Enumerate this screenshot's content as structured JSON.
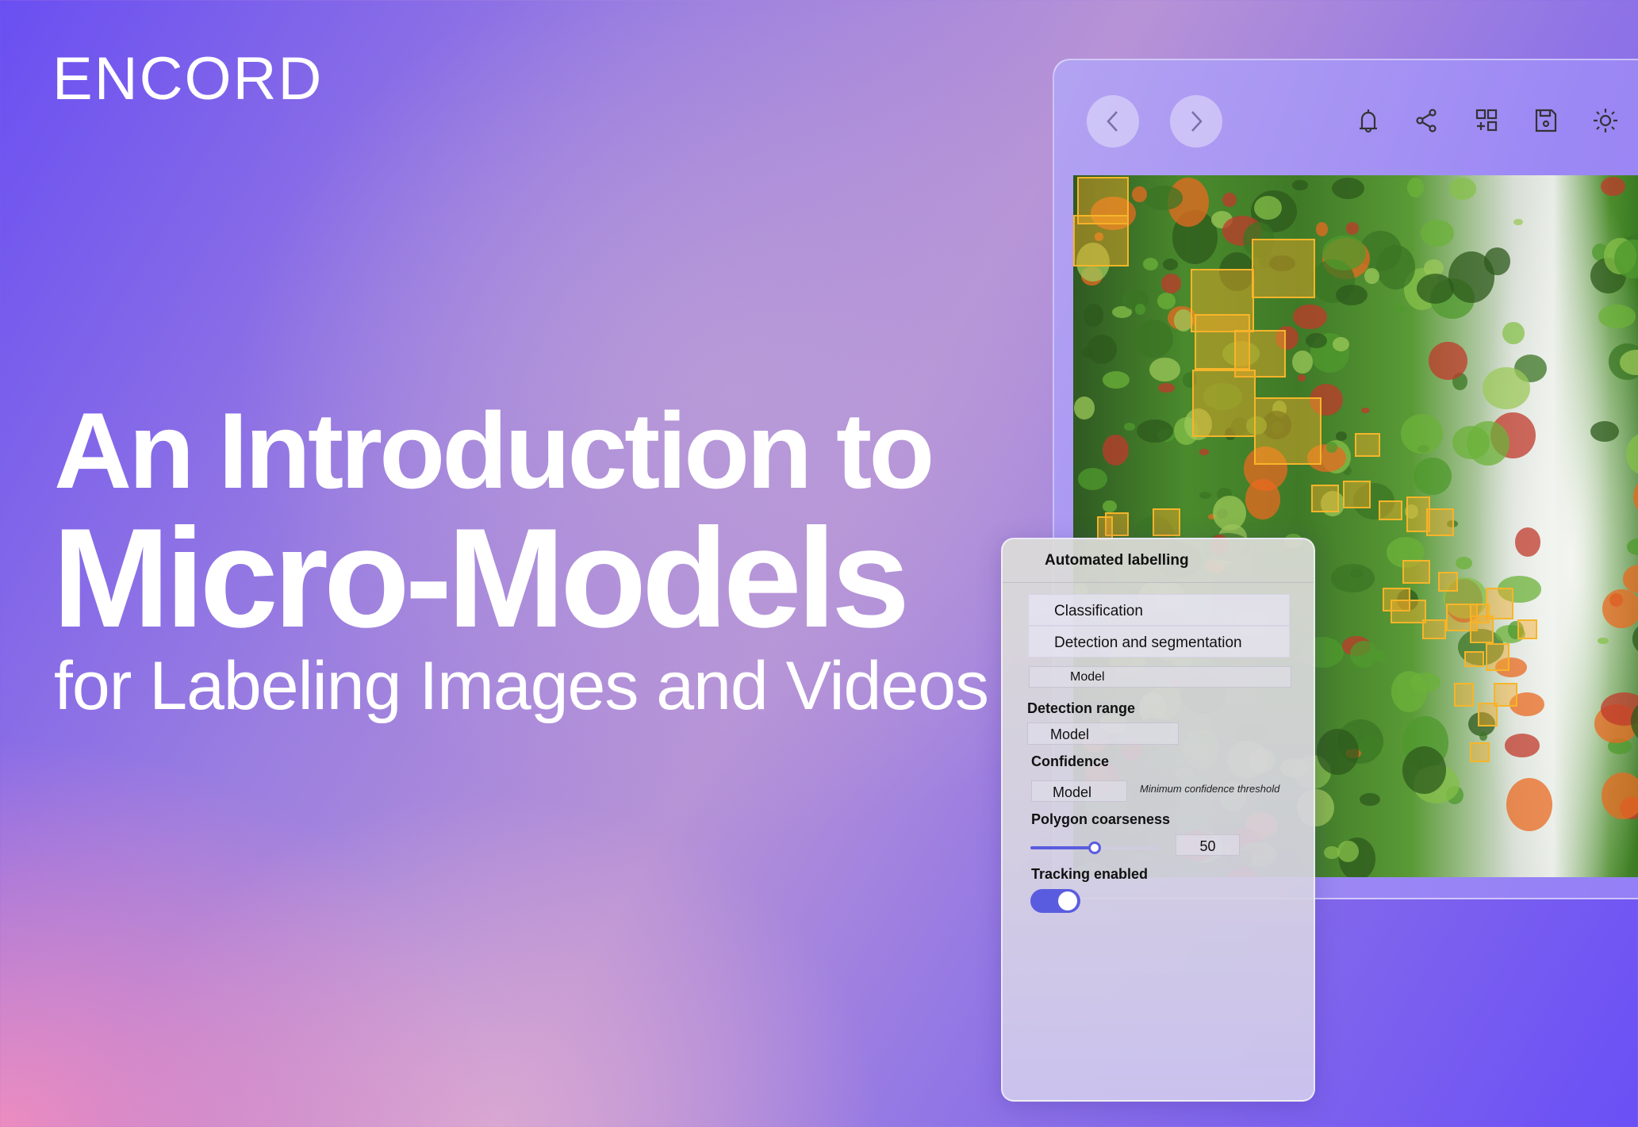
{
  "brand": {
    "logo": "ENCORD"
  },
  "hero": {
    "line1": "An Introduction to",
    "line2": "Micro-Models",
    "line3": "for Labeling Images and Videos"
  },
  "toolbar": {
    "icons": [
      "chevron-left-icon",
      "chevron-right-icon",
      "bell-icon",
      "share-icon",
      "add-widget-icon",
      "save-icon",
      "sun-icon"
    ]
  },
  "panel": {
    "title": "Automated labelling",
    "options": [
      "Classification",
      "Detection and segmentation"
    ],
    "model_select": "Model",
    "detection_range": {
      "label": "Detection range",
      "value": "Model"
    },
    "confidence": {
      "label": "Confidence",
      "value": "Model",
      "hint": "Minimum confidence threshold"
    },
    "polygon": {
      "label": "Polygon coarseness",
      "value": "50",
      "slider_percent": 50
    },
    "tracking": {
      "label": "Tracking enabled",
      "on": true
    }
  },
  "colors": {
    "accent": "#5a5ce0",
    "bbox": "#f6b52a",
    "bg_purple": "#6a4ff2",
    "bg_pink": "#ec8cc0"
  }
}
